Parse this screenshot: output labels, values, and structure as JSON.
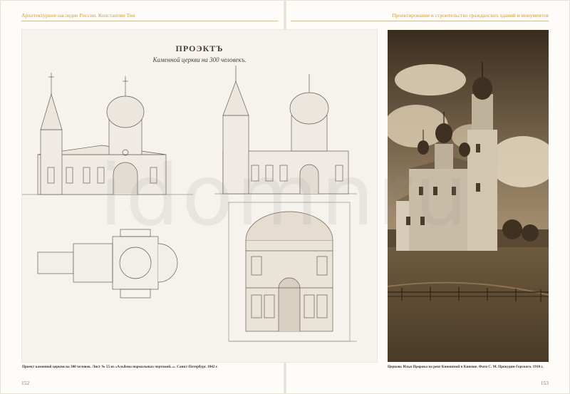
{
  "header": {
    "left_running_head": "Архитектурное наследие России. Константин Тон",
    "right_running_head": "Проектирование и строительство гражданских зданий и монументов"
  },
  "plate": {
    "title": "ПРОЭКТЪ",
    "subtitle": "Каменной церкви на 300 человекъ."
  },
  "captions": {
    "left": "Проект каменной церкви на 300 человек. Лист № 55 из «Альбома нормальных чертежей...». Санкт-Петербург. 1842 г.",
    "right": "Церковь Ильи Пророка на реке Кинешмой в Кинеше. Фото С. М. Прокудин-Горского. 1910 г."
  },
  "folios": {
    "left": "152",
    "right": "153"
  },
  "watermark": "idomnru",
  "colors": {
    "accent": "#d79a3c",
    "sepia_dark": "#3d2e1f",
    "sepia_light": "#d9c7a8"
  }
}
